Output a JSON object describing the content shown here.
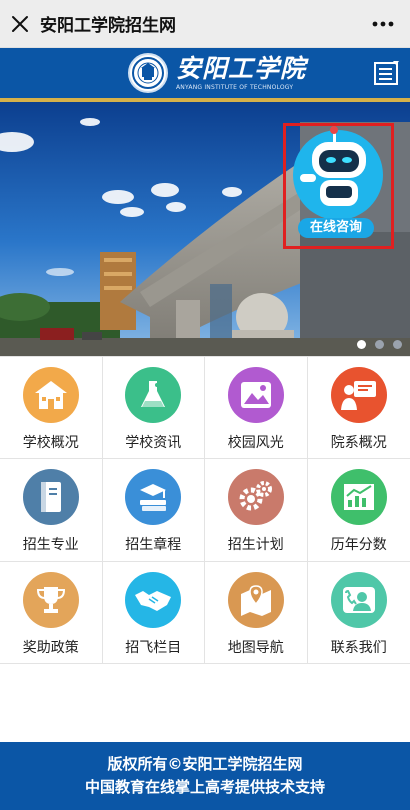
{
  "topbar": {
    "title": "安阳工学院招生网",
    "close_icon": "close-icon",
    "more_icon": "more-icon"
  },
  "header": {
    "logo_cn": "安阳工学院",
    "logo_en": "ANYANG INSTITUTE OF TECHNOLOGY",
    "menu_icon": "menu-icon"
  },
  "banner": {
    "robot_label": "在线咨询",
    "slide_count": 3,
    "active_slide": 1
  },
  "grid": {
    "items": [
      {
        "label": "学校概况",
        "icon": "school-icon",
        "color": "#f2a94a"
      },
      {
        "label": "学校资讯",
        "icon": "flask-icon",
        "color": "#3bbf8a"
      },
      {
        "label": "校园风光",
        "icon": "picture-icon",
        "color": "#b15ad0"
      },
      {
        "label": "院系概况",
        "icon": "presenter-icon",
        "color": "#e8532f"
      },
      {
        "label": "招生专业",
        "icon": "book-icon",
        "color": "#4f7fa8"
      },
      {
        "label": "招生章程",
        "icon": "books-icon",
        "color": "#3a8fd8"
      },
      {
        "label": "招生计划",
        "icon": "gears-icon",
        "color": "#c97a6b"
      },
      {
        "label": "历年分数",
        "icon": "chart-icon",
        "color": "#3fbf6b"
      },
      {
        "label": "奖助政策",
        "icon": "trophy-icon",
        "color": "#e3a55a"
      },
      {
        "label": "招飞栏目",
        "icon": "handshake-icon",
        "color": "#25b6e6"
      },
      {
        "label": "地图导航",
        "icon": "map-icon",
        "color": "#d99852"
      },
      {
        "label": "联系我们",
        "icon": "contact-icon",
        "color": "#4fc7a8"
      }
    ]
  },
  "footer": {
    "line1": "版权所有©安阳工学院招生网",
    "line2": "中国教育在线掌上高考提供技术支持"
  }
}
